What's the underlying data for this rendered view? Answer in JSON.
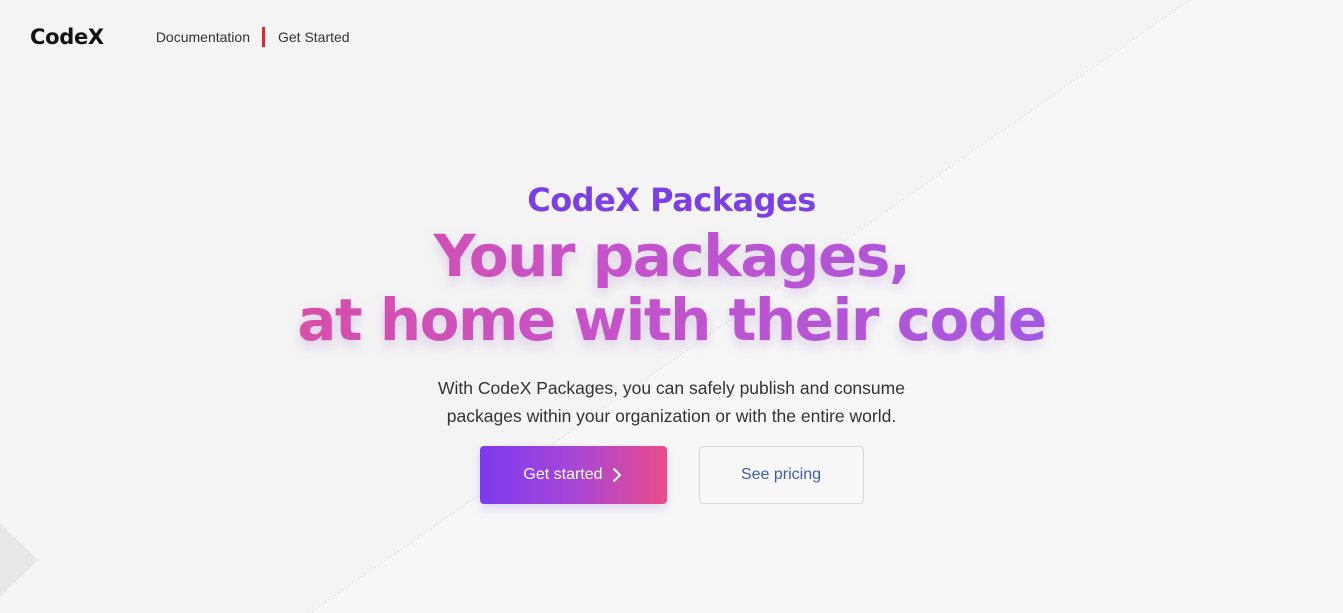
{
  "nav": {
    "logo": "CodeX",
    "links": [
      "Documentation",
      "Get Started"
    ]
  },
  "hero": {
    "eyebrow": "CodeX Packages",
    "headline_line1": "Your packages,",
    "headline_line2": "at home with their code",
    "subtitle": "With CodeX Packages, you can safely publish and consume packages within your organization or with the entire world.",
    "primary_button": "Get started",
    "secondary_button": "See pricing"
  },
  "colors": {
    "accent_purple": "#7b3fe4",
    "accent_pink": "#ea4c89",
    "nav_separator": "#e3242b",
    "secondary_text": "#3f5bb8"
  },
  "icons": {
    "primary_button_icon": "chevron-right-icon"
  }
}
